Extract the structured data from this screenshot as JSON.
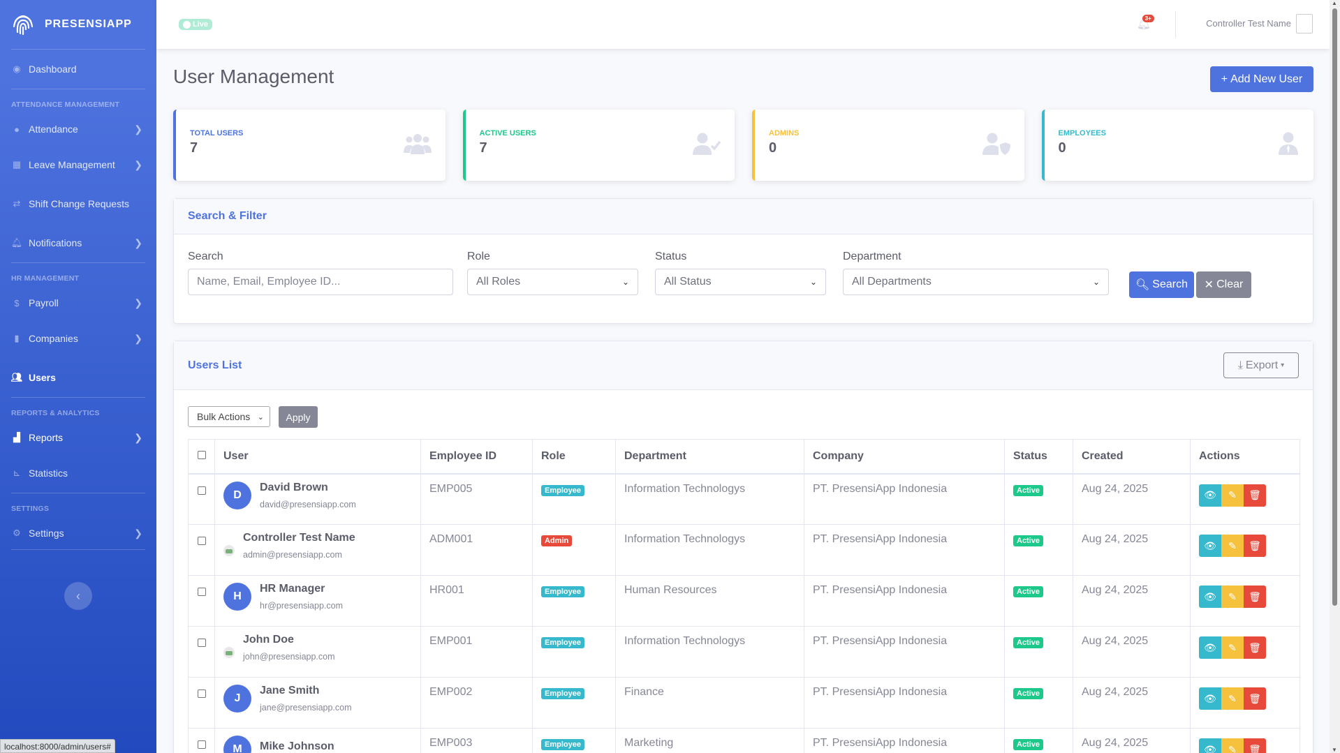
{
  "brand": {
    "name": "PRESENSIAPP"
  },
  "sidebar": {
    "dashboard": "Dashboard",
    "heading_attendance": "ATTENDANCE MANAGEMENT",
    "attendance": "Attendance",
    "leave": "Leave Management",
    "shift": "Shift Change Requests",
    "notifications": "Notifications",
    "heading_hr": "HR MANAGEMENT",
    "payroll": "Payroll",
    "companies": "Companies",
    "users": "Users",
    "heading_reports": "REPORTS & ANALYTICS",
    "reports": "Reports",
    "statistics": "Statistics",
    "heading_settings": "SETTINGS",
    "settings": "Settings"
  },
  "topbar": {
    "live": "Live",
    "notif_count": "3+",
    "user_name": "Controller Test Name"
  },
  "statusbar": "localhost:8000/admin/users#",
  "page": {
    "title": "User Management",
    "add_button": "Add New User"
  },
  "stats": [
    {
      "label": "TOTAL USERS",
      "value": "7",
      "color": "#4e73df",
      "icon": "users-icon"
    },
    {
      "label": "ACTIVE USERS",
      "value": "7",
      "color": "#1cc88a",
      "icon": "user-check-icon"
    },
    {
      "label": "ADMINS",
      "value": "0",
      "color": "#f6c23e",
      "icon": "user-shield-icon"
    },
    {
      "label": "EMPLOYEES",
      "value": "0",
      "color": "#36b9cc",
      "icon": "user-tie-icon"
    }
  ],
  "filter": {
    "title": "Search & Filter",
    "search_label": "Search",
    "search_placeholder": "Name, Email, Employee ID...",
    "role_label": "Role",
    "role_value": "All Roles",
    "status_label": "Status",
    "status_value": "All Status",
    "department_label": "Department",
    "department_value": "All Departments",
    "search_button": "Search",
    "clear_button": "Clear"
  },
  "users_list": {
    "title": "Users List",
    "export": "Export",
    "bulk": "Bulk Actions",
    "apply": "Apply",
    "columns": [
      "User",
      "Employee ID",
      "Role",
      "Department",
      "Company",
      "Status",
      "Created",
      "Actions"
    ],
    "rows": [
      {
        "initial": "D",
        "name": "David Brown",
        "email": "david@presensiapp.com",
        "emp_id": "EMP005",
        "role": "Employee",
        "department": "Information Technologys",
        "company": "PT. PresensiApp Indonesia",
        "status": "Active",
        "created": "Aug 24, 2025"
      },
      {
        "initial": "",
        "name": "Controller Test Name",
        "email": "admin@presensiapp.com",
        "emp_id": "ADM001",
        "role": "Admin",
        "department": "Information Technologys",
        "company": "PT. PresensiApp Indonesia",
        "status": "Active",
        "created": "Aug 24, 2025"
      },
      {
        "initial": "H",
        "name": "HR Manager",
        "email": "hr@presensiapp.com",
        "emp_id": "HR001",
        "role": "Employee",
        "department": "Human Resources",
        "company": "PT. PresensiApp Indonesia",
        "status": "Active",
        "created": "Aug 24, 2025"
      },
      {
        "initial": "",
        "name": "John Doe",
        "email": "john@presensiapp.com",
        "emp_id": "EMP001",
        "role": "Employee",
        "department": "Information Technologys",
        "company": "PT. PresensiApp Indonesia",
        "status": "Active",
        "created": "Aug 24, 2025"
      },
      {
        "initial": "J",
        "name": "Jane Smith",
        "email": "jane@presensiapp.com",
        "emp_id": "EMP002",
        "role": "Employee",
        "department": "Finance",
        "company": "PT. PresensiApp Indonesia",
        "status": "Active",
        "created": "Aug 24, 2025"
      },
      {
        "initial": "M",
        "name": "Mike Johnson",
        "email": "",
        "emp_id": "EMP003",
        "role": "Employee",
        "department": "Marketing",
        "company": "PT. PresensiApp Indonesia",
        "status": "Active",
        "created": "Aug 24, 2025"
      }
    ]
  }
}
